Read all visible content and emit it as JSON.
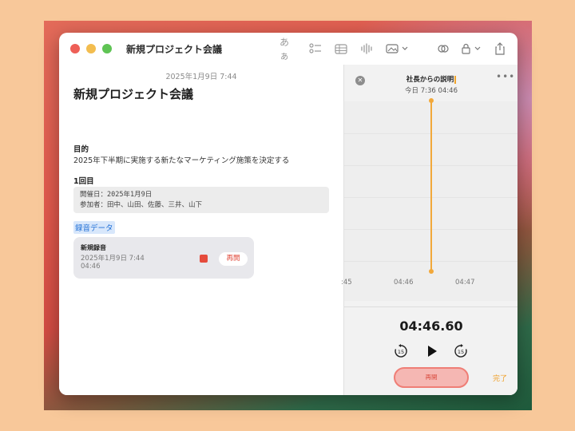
{
  "window": {
    "title": "新規プロジェクト会議",
    "toolbar": {
      "format_label": "あぁ"
    }
  },
  "note": {
    "date": "2025年1月9日 7:44",
    "title": "新規プロジェクト会議",
    "purpose_heading": "目的",
    "purpose_text": "2025年下半期に実施する新たなマーケティング施策を決定する",
    "round_heading": "1回目",
    "info_line1": "開催日：2025年1月9日",
    "info_line2": "参加者：田中、山田、佐藤、三井、山下",
    "recording_section_label": "録音データ",
    "recording": {
      "name": "新規録音",
      "date": "2025年1月9日 7:44",
      "duration": "04:46",
      "play_label": "再開"
    }
  },
  "recorder": {
    "title": "社長からの説明",
    "subtitle": "今日 7:36   04:46",
    "ticks": [
      ":45",
      "04:46",
      "04:47"
    ],
    "timecode": "04:46.60",
    "skip_back_label": "15",
    "skip_forward_label": "15",
    "resume_label": "再開",
    "done_label": "完了"
  },
  "colors": {
    "accent": "#f0a02a",
    "record_red": "#e54b3c",
    "link_blue": "#1f6fd6"
  }
}
